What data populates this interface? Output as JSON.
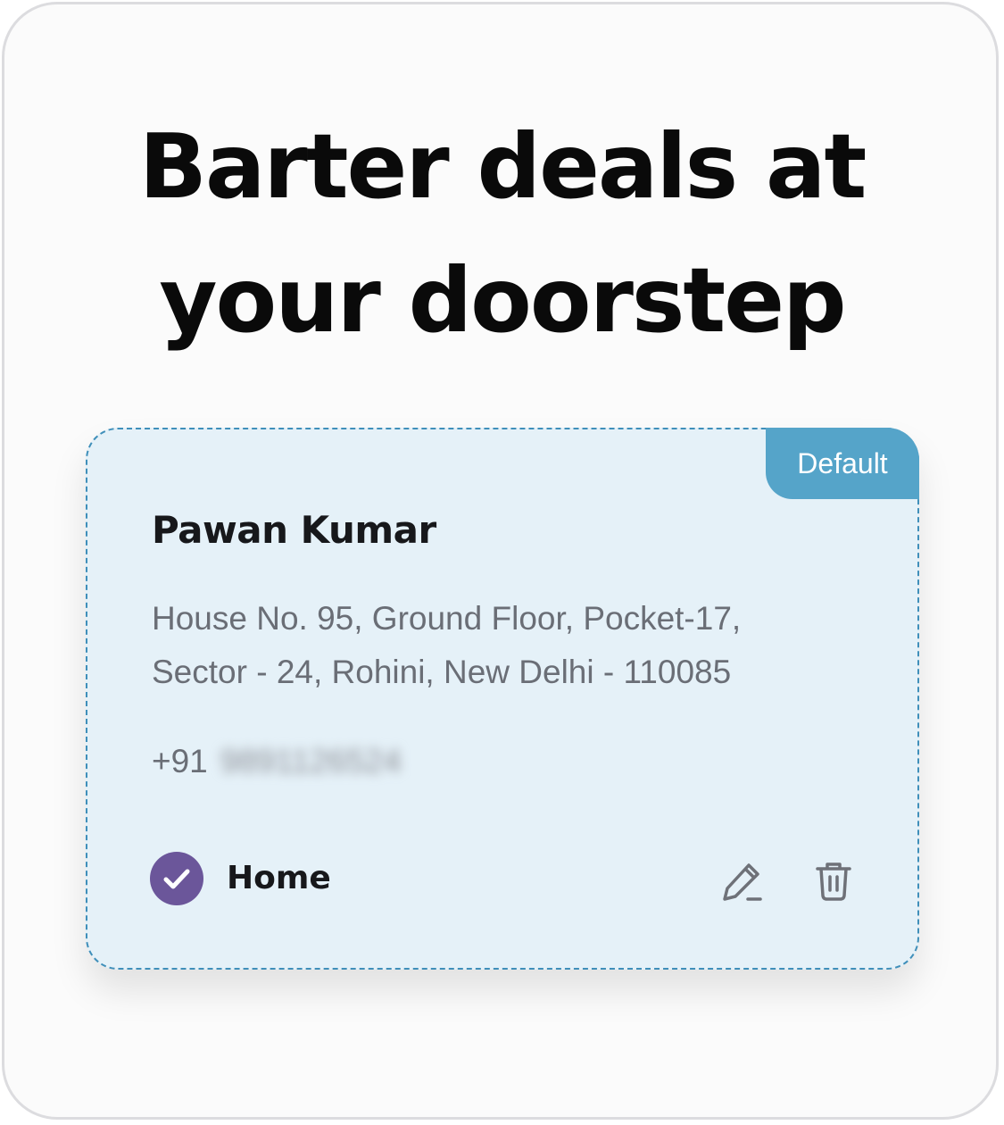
{
  "headline": {
    "line1": "Barter deals at",
    "line2": "your doorstep"
  },
  "address_card": {
    "badge": "Default",
    "name": "Pawan Kumar",
    "address_line1": "House No. 95, Ground Floor, Pocket-17,",
    "address_line2": "Sector - 24, Rohini, New Delhi - 110085",
    "phone_prefix": "+91",
    "phone_number": "9891126524",
    "address_type": "Home",
    "selected": true,
    "icons": {
      "selected": "check-circle-icon",
      "edit": "pencil-icon",
      "delete": "trash-icon"
    },
    "colors": {
      "card_background": "#e5f1f8",
      "card_border": "#3f8fba",
      "badge_background": "#55a4c9",
      "check_background": "#6b569a"
    }
  }
}
